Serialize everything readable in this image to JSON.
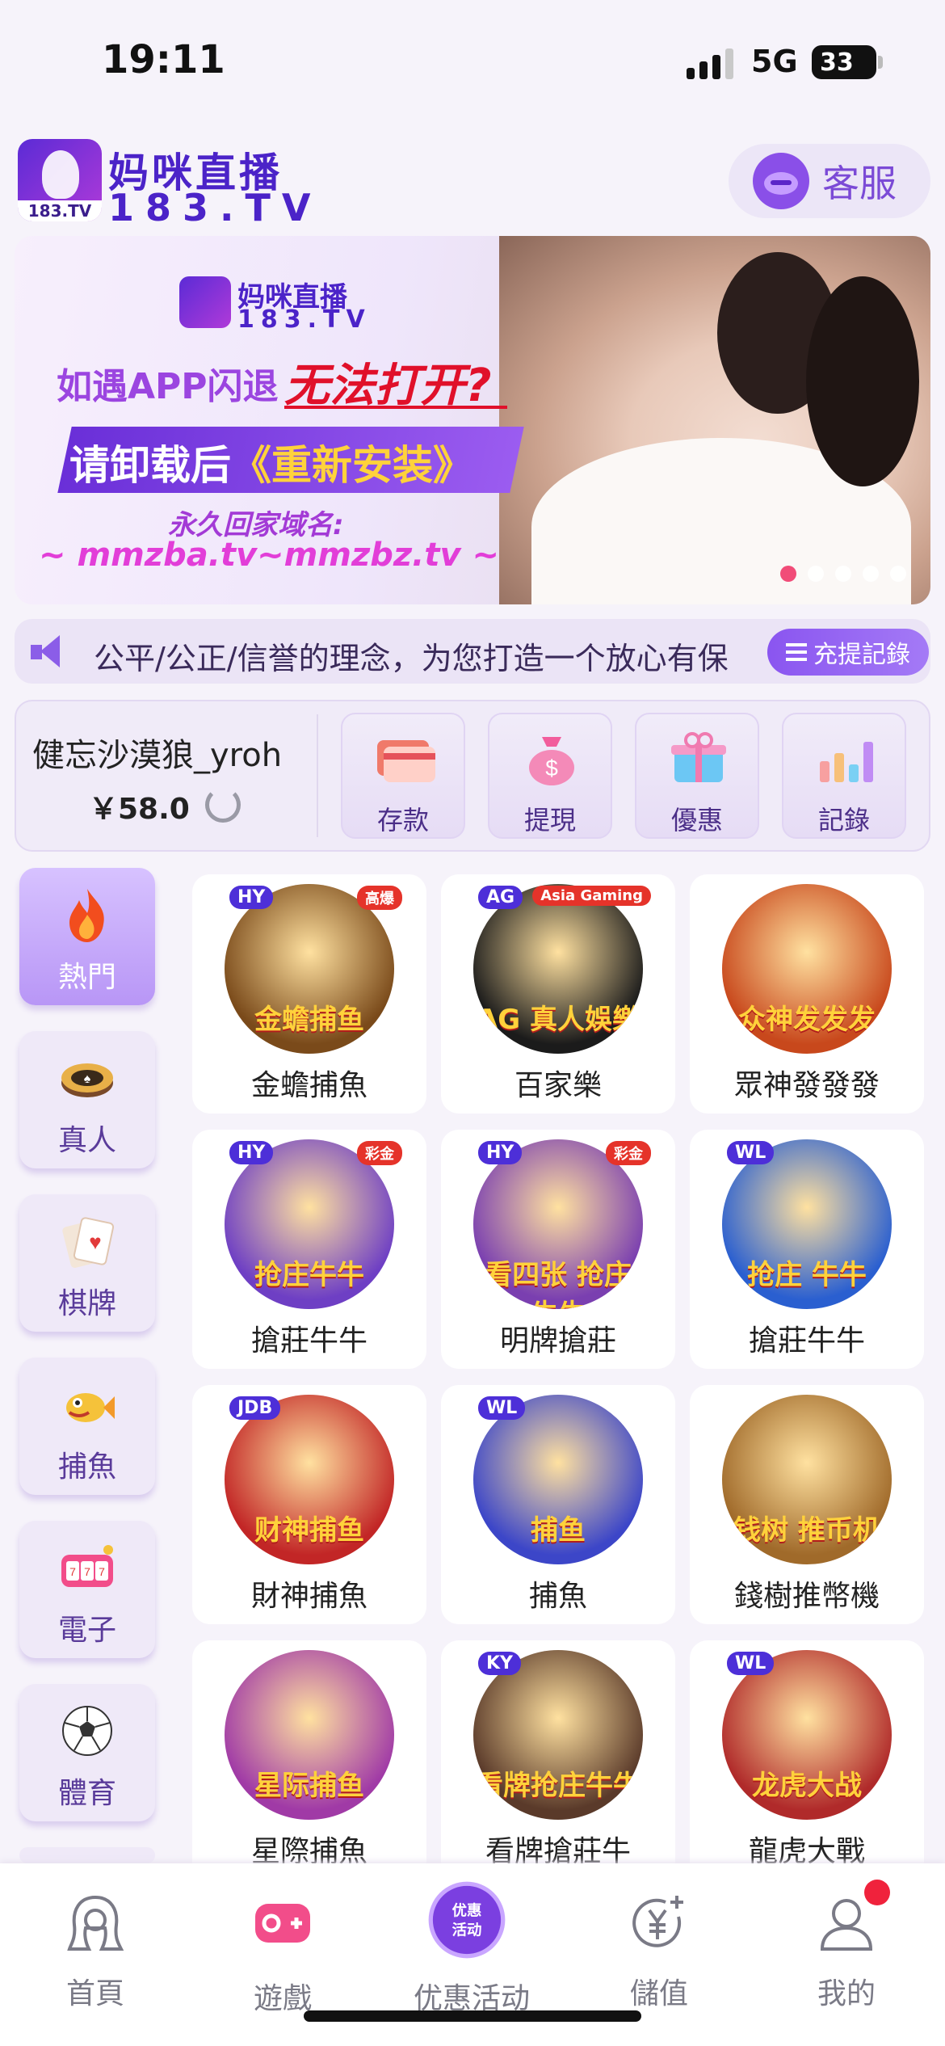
{
  "status_bar": {
    "time": "19:11",
    "network": "5G",
    "battery": "33"
  },
  "header": {
    "logo_title": "妈咪直播",
    "logo_domain": "183.TV",
    "logo_badge": "183.TV",
    "service_label": "客服"
  },
  "banner": {
    "logo_title": "妈咪直播",
    "logo_domain": "183.TV",
    "line1_prefix": "如遇APP闪退",
    "line1_highlight": "无法打开?",
    "ribbon_prefix": "请卸载后",
    "ribbon_highlight": "《重新安装》",
    "line3": "永久回家域名:",
    "line4": "~ mmzba.tv~mmzbz.tv ~",
    "slides": 5,
    "active_slide": 1
  },
  "marquee": {
    "text": "公平/公正/信誉的理念，为您打造一个放心有保",
    "records_label": "充提記錄"
  },
  "account": {
    "username": "健忘沙漠狼_yroh",
    "balance": "￥58.0",
    "actions": [
      {
        "label": "存款",
        "icon": "card-icon"
      },
      {
        "label": "提現",
        "icon": "money-bag-icon"
      },
      {
        "label": "優惠",
        "icon": "gift-icon"
      },
      {
        "label": "記錄",
        "icon": "bar-chart-icon"
      }
    ]
  },
  "categories": [
    {
      "label": "熱門",
      "icon": "fire-icon",
      "active": true
    },
    {
      "label": "真人",
      "icon": "poker-chip-icon",
      "active": false
    },
    {
      "label": "棋牌",
      "icon": "playing-card-icon",
      "active": false
    },
    {
      "label": "捕魚",
      "icon": "fish-icon",
      "active": false
    },
    {
      "label": "電子",
      "icon": "slot-machine-icon",
      "active": false
    },
    {
      "label": "體育",
      "icon": "soccer-ball-icon",
      "active": false
    }
  ],
  "games": [
    {
      "label": "金蟾捕魚",
      "badge": "HY",
      "art_text": "金蟾捕鱼",
      "corner": "高爆",
      "color": "#7a4a1a"
    },
    {
      "label": "百家樂",
      "badge": "AG",
      "art_text": "AG 真人娛樂",
      "corner": "Asia Gaming",
      "color": "#1b1b1b"
    },
    {
      "label": "眾神發發發",
      "badge": "",
      "art_text": "众神发发发",
      "corner": "",
      "color": "#c8481c"
    },
    {
      "label": "搶莊牛牛",
      "badge": "HY",
      "art_text": "抢庄牛牛",
      "corner": "彩金",
      "color": "#6e3fc4"
    },
    {
      "label": "明牌搶莊",
      "badge": "HY",
      "art_text": "看四张 抢庄牛牛",
      "corner": "彩金",
      "color": "#7a3fb0"
    },
    {
      "label": "搶莊牛牛",
      "badge": "WL",
      "art_text": "抢庄 牛牛",
      "corner": "",
      "color": "#2a5fd0"
    },
    {
      "label": "財神捕魚",
      "badge": "JDB",
      "art_text": "财神捕鱼",
      "corner": "",
      "color": "#c22626"
    },
    {
      "label": "捕魚",
      "badge": "WL",
      "art_text": "捕鱼",
      "corner": "",
      "color": "#3c46c8"
    },
    {
      "label": "錢樹推幣機",
      "badge": "",
      "art_text": "钱树 推币机",
      "corner": "",
      "color": "#a06a2a"
    },
    {
      "label": "星際捕魚",
      "badge": "",
      "art_text": "星际捕鱼",
      "corner": "",
      "color": "#a03aa6"
    },
    {
      "label": "看牌搶莊牛",
      "badge": "KY",
      "art_text": "看牌抢庄牛牛",
      "corner": "",
      "color": "#5a3a2a"
    },
    {
      "label": "龍虎大戰",
      "badge": "WL",
      "art_text": "龙虎大战",
      "corner": "",
      "color": "#b02a2a"
    }
  ],
  "tabbar": [
    {
      "label": "首頁",
      "icon": "avatar-girl-icon"
    },
    {
      "label": "遊戲",
      "icon": "gamepad-icon"
    },
    {
      "label": "优惠活动",
      "icon": "promo-badge-icon",
      "badge_text": "优惠活动"
    },
    {
      "label": "儲值",
      "icon": "yuan-plus-icon"
    },
    {
      "label": "我的",
      "icon": "user-icon"
    }
  ]
}
